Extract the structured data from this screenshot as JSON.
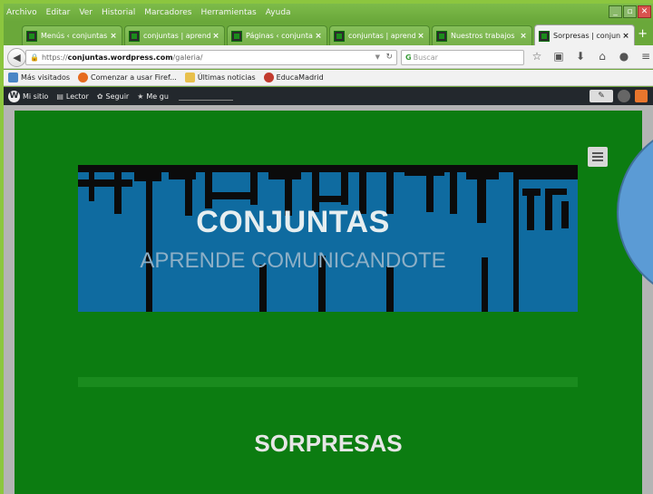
{
  "menubar": {
    "items": [
      "Archivo",
      "Editar",
      "Ver",
      "Historial",
      "Marcadores",
      "Herramientas",
      "Ayuda"
    ]
  },
  "tabs": [
    {
      "title": "Menús ‹ conjuntas ...",
      "active": false
    },
    {
      "title": "conjuntas | aprend...",
      "active": false
    },
    {
      "title": "Páginas ‹ conjunta...",
      "active": false
    },
    {
      "title": "conjuntas | aprend...",
      "active": false
    },
    {
      "title": "Nuestros trabajos ...",
      "active": false
    },
    {
      "title": "Sorpresas | conjun...",
      "active": true
    }
  ],
  "navbar": {
    "url_prefix": "https://",
    "url_host": "conjuntas.wordpress.com",
    "url_path": "/galeria/",
    "search_placeholder": "Buscar"
  },
  "bookmarks": [
    {
      "label": "Más visitados",
      "icon": "most-visited-icon"
    },
    {
      "label": "Comenzar a usar Firef...",
      "icon": "firefox-icon"
    },
    {
      "label": "Últimas noticias",
      "icon": "rss-folder-icon"
    },
    {
      "label": "EducaMadrid",
      "icon": "educamadrid-icon"
    }
  ],
  "wpbar": {
    "logo": "W",
    "my_site": "Mi sitio",
    "reader": "Lector",
    "follow": "Seguir",
    "like": "Me gu"
  },
  "site": {
    "title": "CONJUNTAS",
    "tagline": "APRENDE COMUNICANDOTE",
    "section_title": "SORPRESAS"
  },
  "colors": {
    "slide_bg": "#8cc63f",
    "site_bg": "#0c7c11",
    "banner_bg": "#0f6ba0",
    "circle": "#5b9bd5"
  }
}
